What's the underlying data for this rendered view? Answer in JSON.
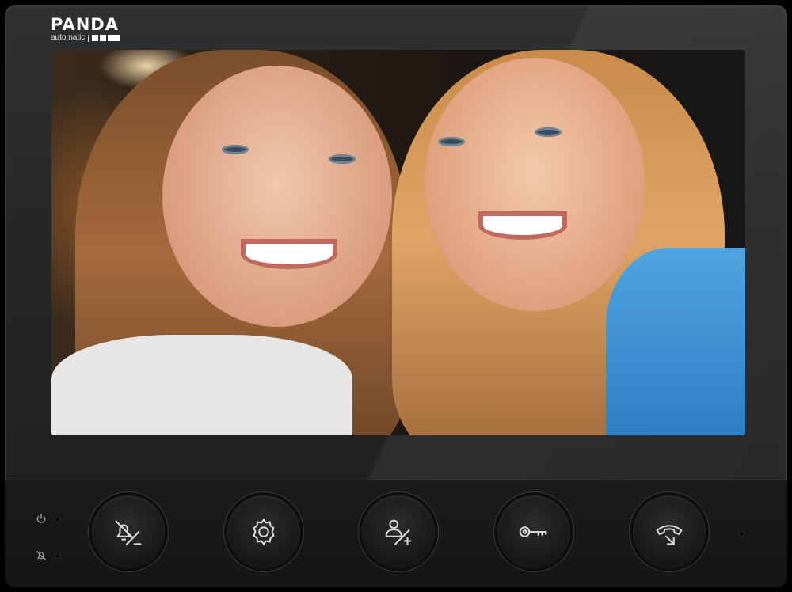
{
  "brand": {
    "name": "PANDA",
    "tagline": "automatic"
  },
  "screen": {
    "content": "video-feed"
  },
  "status_indicators": [
    {
      "name": "power",
      "icon": "power-icon"
    },
    {
      "name": "mute",
      "icon": "bell-off-icon"
    }
  ],
  "buttons": [
    {
      "name": "mute-volume-down",
      "icon": "bell-off-minus-icon"
    },
    {
      "name": "settings",
      "icon": "gear-icon"
    },
    {
      "name": "contacts-volume-up",
      "icon": "user-plus-icon"
    },
    {
      "name": "unlock",
      "icon": "key-icon"
    },
    {
      "name": "call",
      "icon": "handset-icon"
    }
  ],
  "colors": {
    "body": "#252628",
    "button_icon": "#d8d8d8",
    "brand_text": "#ffffff"
  }
}
